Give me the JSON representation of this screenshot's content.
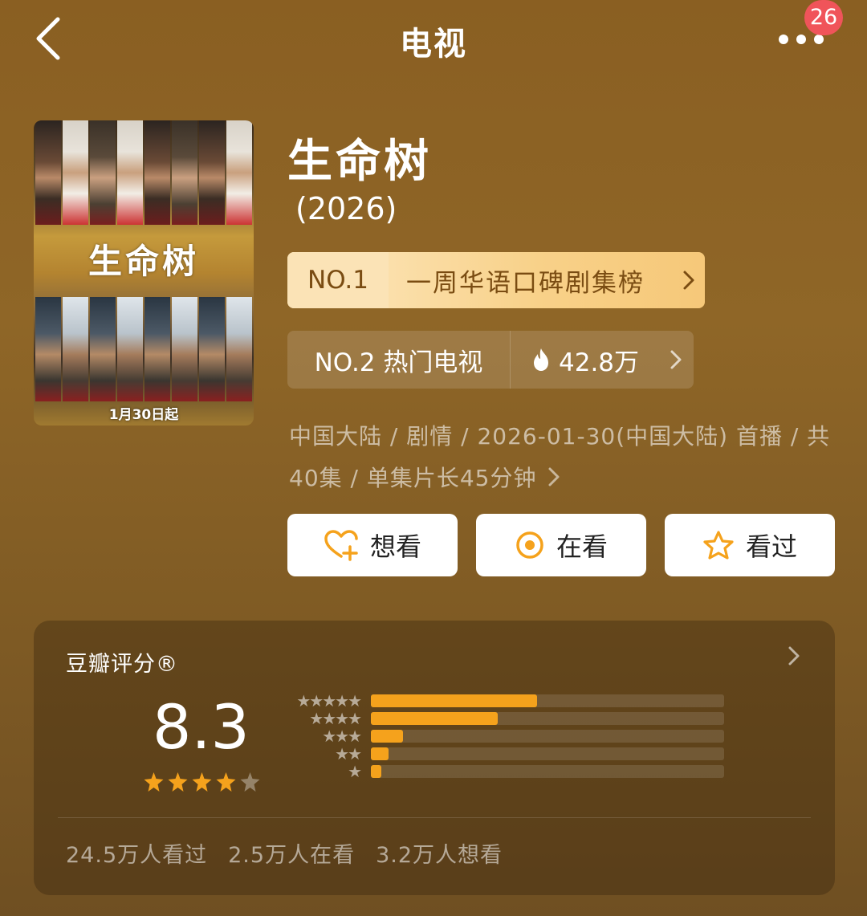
{
  "header": {
    "title": "电视",
    "notification_count": "26"
  },
  "poster": {
    "calligraphy": "生命树",
    "release_note": "1月30日起"
  },
  "show": {
    "title": "生命树",
    "year": "(2026)"
  },
  "rank_badge": {
    "rank": "NO.1",
    "list_name": "一周华语口碑剧集榜"
  },
  "hot_badge": {
    "label": "NO.2 热门电视",
    "value": "42.8万"
  },
  "meta": {
    "line1": "中国大陆 / 剧情 / 2026-01-30(中国大陆) 首播 / 共",
    "line2": "40集 / 单集片长45分钟"
  },
  "actions": {
    "want": "想看",
    "watching": "在看",
    "watched": "看过"
  },
  "rating": {
    "title": "豆瓣评分®",
    "score": "8.3",
    "stars": 4,
    "max_stars": 5,
    "distribution": [
      {
        "stars": 5,
        "fraction": 0.47
      },
      {
        "stars": 4,
        "fraction": 0.36
      },
      {
        "stars": 3,
        "fraction": 0.09
      },
      {
        "stars": 2,
        "fraction": 0.05
      },
      {
        "stars": 1,
        "fraction": 0.03
      }
    ],
    "stats": {
      "watched": "24.5万人看过",
      "watching": "2.5万人在看",
      "want": "3.2万人想看"
    }
  },
  "colors": {
    "background": "#8a5f22",
    "accent_orange": "#f5a21c",
    "rank_text": "#7a4c12",
    "badge_red": "#f0545a"
  },
  "icons": {
    "back": "chevron-left-icon",
    "more": "more-dots-icon",
    "fire": "fire-icon",
    "want": "heart-plus-icon",
    "watching": "target-circle-icon",
    "watched": "star-outline-icon"
  }
}
